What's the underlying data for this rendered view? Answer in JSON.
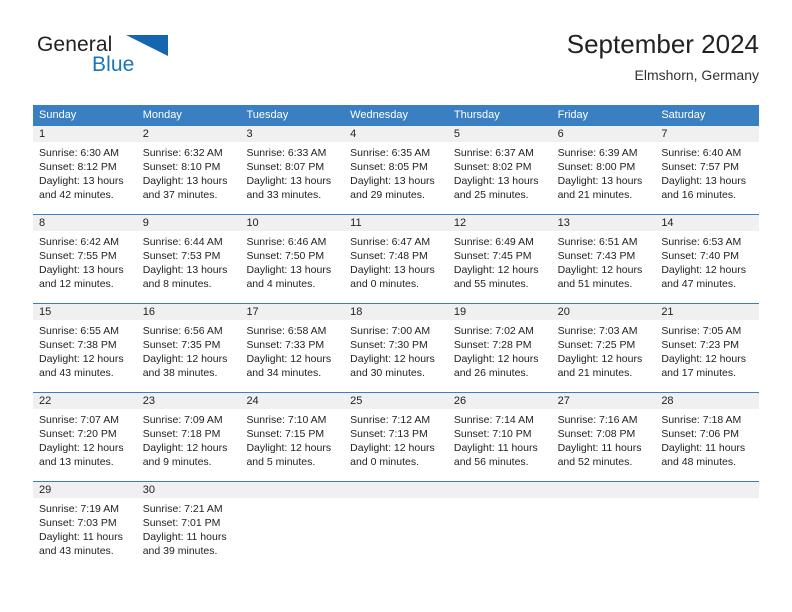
{
  "brand": {
    "name_part1": "General",
    "name_part2": "Blue",
    "triangle_color": "#1565b0",
    "blue_color": "#1b75bc"
  },
  "header": {
    "title": "September 2024",
    "subtitle": "Elmshorn, Germany"
  },
  "theme": {
    "header_row_bg": "#3a7fc1",
    "daynum_row_bg": "#f0f0f0",
    "separator_color": "#3a7fc1",
    "text_color": "#222222"
  },
  "day_headers": [
    "Sunday",
    "Monday",
    "Tuesday",
    "Wednesday",
    "Thursday",
    "Friday",
    "Saturday"
  ],
  "weeks": [
    {
      "days": [
        {
          "num": "1",
          "sunrise": "Sunrise: 6:30 AM",
          "sunset": "Sunset: 8:12 PM",
          "daylight1": "Daylight: 13 hours",
          "daylight2": "and 42 minutes."
        },
        {
          "num": "2",
          "sunrise": "Sunrise: 6:32 AM",
          "sunset": "Sunset: 8:10 PM",
          "daylight1": "Daylight: 13 hours",
          "daylight2": "and 37 minutes."
        },
        {
          "num": "3",
          "sunrise": "Sunrise: 6:33 AM",
          "sunset": "Sunset: 8:07 PM",
          "daylight1": "Daylight: 13 hours",
          "daylight2": "and 33 minutes."
        },
        {
          "num": "4",
          "sunrise": "Sunrise: 6:35 AM",
          "sunset": "Sunset: 8:05 PM",
          "daylight1": "Daylight: 13 hours",
          "daylight2": "and 29 minutes."
        },
        {
          "num": "5",
          "sunrise": "Sunrise: 6:37 AM",
          "sunset": "Sunset: 8:02 PM",
          "daylight1": "Daylight: 13 hours",
          "daylight2": "and 25 minutes."
        },
        {
          "num": "6",
          "sunrise": "Sunrise: 6:39 AM",
          "sunset": "Sunset: 8:00 PM",
          "daylight1": "Daylight: 13 hours",
          "daylight2": "and 21 minutes."
        },
        {
          "num": "7",
          "sunrise": "Sunrise: 6:40 AM",
          "sunset": "Sunset: 7:57 PM",
          "daylight1": "Daylight: 13 hours",
          "daylight2": "and 16 minutes."
        }
      ]
    },
    {
      "days": [
        {
          "num": "8",
          "sunrise": "Sunrise: 6:42 AM",
          "sunset": "Sunset: 7:55 PM",
          "daylight1": "Daylight: 13 hours",
          "daylight2": "and 12 minutes."
        },
        {
          "num": "9",
          "sunrise": "Sunrise: 6:44 AM",
          "sunset": "Sunset: 7:53 PM",
          "daylight1": "Daylight: 13 hours",
          "daylight2": "and 8 minutes."
        },
        {
          "num": "10",
          "sunrise": "Sunrise: 6:46 AM",
          "sunset": "Sunset: 7:50 PM",
          "daylight1": "Daylight: 13 hours",
          "daylight2": "and 4 minutes."
        },
        {
          "num": "11",
          "sunrise": "Sunrise: 6:47 AM",
          "sunset": "Sunset: 7:48 PM",
          "daylight1": "Daylight: 13 hours",
          "daylight2": "and 0 minutes."
        },
        {
          "num": "12",
          "sunrise": "Sunrise: 6:49 AM",
          "sunset": "Sunset: 7:45 PM",
          "daylight1": "Daylight: 12 hours",
          "daylight2": "and 55 minutes."
        },
        {
          "num": "13",
          "sunrise": "Sunrise: 6:51 AM",
          "sunset": "Sunset: 7:43 PM",
          "daylight1": "Daylight: 12 hours",
          "daylight2": "and 51 minutes."
        },
        {
          "num": "14",
          "sunrise": "Sunrise: 6:53 AM",
          "sunset": "Sunset: 7:40 PM",
          "daylight1": "Daylight: 12 hours",
          "daylight2": "and 47 minutes."
        }
      ]
    },
    {
      "days": [
        {
          "num": "15",
          "sunrise": "Sunrise: 6:55 AM",
          "sunset": "Sunset: 7:38 PM",
          "daylight1": "Daylight: 12 hours",
          "daylight2": "and 43 minutes."
        },
        {
          "num": "16",
          "sunrise": "Sunrise: 6:56 AM",
          "sunset": "Sunset: 7:35 PM",
          "daylight1": "Daylight: 12 hours",
          "daylight2": "and 38 minutes."
        },
        {
          "num": "17",
          "sunrise": "Sunrise: 6:58 AM",
          "sunset": "Sunset: 7:33 PM",
          "daylight1": "Daylight: 12 hours",
          "daylight2": "and 34 minutes."
        },
        {
          "num": "18",
          "sunrise": "Sunrise: 7:00 AM",
          "sunset": "Sunset: 7:30 PM",
          "daylight1": "Daylight: 12 hours",
          "daylight2": "and 30 minutes."
        },
        {
          "num": "19",
          "sunrise": "Sunrise: 7:02 AM",
          "sunset": "Sunset: 7:28 PM",
          "daylight1": "Daylight: 12 hours",
          "daylight2": "and 26 minutes."
        },
        {
          "num": "20",
          "sunrise": "Sunrise: 7:03 AM",
          "sunset": "Sunset: 7:25 PM",
          "daylight1": "Daylight: 12 hours",
          "daylight2": "and 21 minutes."
        },
        {
          "num": "21",
          "sunrise": "Sunrise: 7:05 AM",
          "sunset": "Sunset: 7:23 PM",
          "daylight1": "Daylight: 12 hours",
          "daylight2": "and 17 minutes."
        }
      ]
    },
    {
      "days": [
        {
          "num": "22",
          "sunrise": "Sunrise: 7:07 AM",
          "sunset": "Sunset: 7:20 PM",
          "daylight1": "Daylight: 12 hours",
          "daylight2": "and 13 minutes."
        },
        {
          "num": "23",
          "sunrise": "Sunrise: 7:09 AM",
          "sunset": "Sunset: 7:18 PM",
          "daylight1": "Daylight: 12 hours",
          "daylight2": "and 9 minutes."
        },
        {
          "num": "24",
          "sunrise": "Sunrise: 7:10 AM",
          "sunset": "Sunset: 7:15 PM",
          "daylight1": "Daylight: 12 hours",
          "daylight2": "and 5 minutes."
        },
        {
          "num": "25",
          "sunrise": "Sunrise: 7:12 AM",
          "sunset": "Sunset: 7:13 PM",
          "daylight1": "Daylight: 12 hours",
          "daylight2": "and 0 minutes."
        },
        {
          "num": "26",
          "sunrise": "Sunrise: 7:14 AM",
          "sunset": "Sunset: 7:10 PM",
          "daylight1": "Daylight: 11 hours",
          "daylight2": "and 56 minutes."
        },
        {
          "num": "27",
          "sunrise": "Sunrise: 7:16 AM",
          "sunset": "Sunset: 7:08 PM",
          "daylight1": "Daylight: 11 hours",
          "daylight2": "and 52 minutes."
        },
        {
          "num": "28",
          "sunrise": "Sunrise: 7:18 AM",
          "sunset": "Sunset: 7:06 PM",
          "daylight1": "Daylight: 11 hours",
          "daylight2": "and 48 minutes."
        }
      ]
    },
    {
      "days": [
        {
          "num": "29",
          "sunrise": "Sunrise: 7:19 AM",
          "sunset": "Sunset: 7:03 PM",
          "daylight1": "Daylight: 11 hours",
          "daylight2": "and 43 minutes."
        },
        {
          "num": "30",
          "sunrise": "Sunrise: 7:21 AM",
          "sunset": "Sunset: 7:01 PM",
          "daylight1": "Daylight: 11 hours",
          "daylight2": "and 39 minutes."
        },
        {
          "num": "",
          "sunrise": "",
          "sunset": "",
          "daylight1": "",
          "daylight2": ""
        },
        {
          "num": "",
          "sunrise": "",
          "sunset": "",
          "daylight1": "",
          "daylight2": ""
        },
        {
          "num": "",
          "sunrise": "",
          "sunset": "",
          "daylight1": "",
          "daylight2": ""
        },
        {
          "num": "",
          "sunrise": "",
          "sunset": "",
          "daylight1": "",
          "daylight2": ""
        },
        {
          "num": "",
          "sunrise": "",
          "sunset": "",
          "daylight1": "",
          "daylight2": ""
        }
      ]
    }
  ]
}
